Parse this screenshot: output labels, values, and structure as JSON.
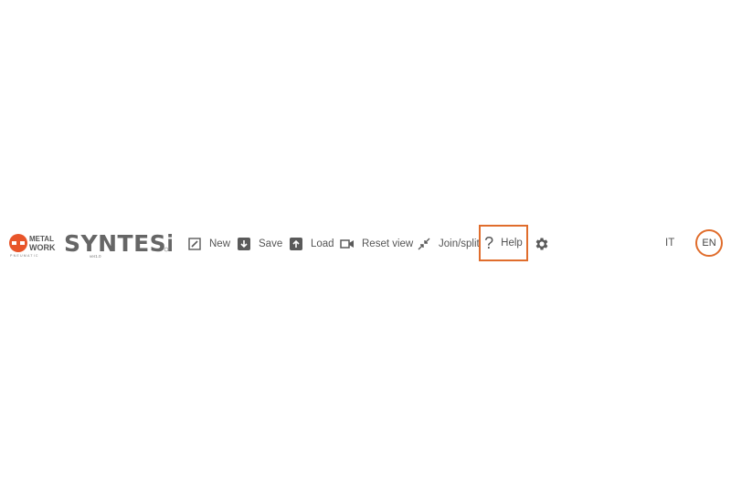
{
  "brand": {
    "company_logo_text": "METAL WORK PNEUMATIC",
    "product_logo_text": "SYNTESi",
    "product_version": "ver1.0"
  },
  "toolbar": {
    "new_label": "New",
    "save_label": "Save",
    "load_label": "Load",
    "reset_view_label": "Reset view",
    "join_split_label": "Join/split",
    "help_label": "Help",
    "help_icon": "question-mark-icon",
    "settings_icon": "gear-icon"
  },
  "language": {
    "options": [
      "IT",
      "EN"
    ],
    "selected": "EN"
  },
  "colors": {
    "accent": "#e06d2c",
    "logo_orange": "#e8552a",
    "text_gray": "#555555",
    "icon_gray": "#5a5a5a"
  }
}
